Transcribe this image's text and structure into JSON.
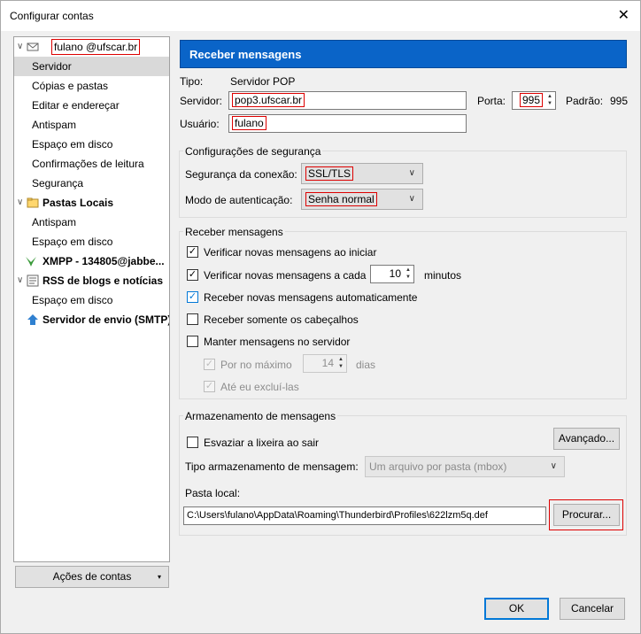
{
  "window": {
    "title": "Configurar contas",
    "close": "✕"
  },
  "tree": {
    "account": "fulano @ufscar.br",
    "account_items": [
      "Servidor",
      "Cópias e pastas",
      "Editar e endereçar",
      "Antispam",
      "Espaço em disco",
      "Confirmações de leitura",
      "Segurança"
    ],
    "local": "Pastas Locais",
    "local_items": [
      "Antispam",
      "Espaço em disco"
    ],
    "xmpp": "XMPP - 134805@jabbe...",
    "rss": "RSS de blogs e notícias",
    "rss_items": [
      "Espaço em disco"
    ],
    "smtp": "Servidor de envio (SMTP)"
  },
  "account_actions": "Ações de contas",
  "header": "Receber mensagens",
  "server": {
    "type_label": "Tipo:",
    "type_value": "Servidor POP",
    "server_label": "Servidor:",
    "server_value": "pop3.ufscar.br",
    "port_label": "Porta:",
    "port_value": "995",
    "default_label": "Padrão:",
    "default_value": "995",
    "user_label": "Usuário:",
    "user_value": "fulano"
  },
  "security": {
    "title": "Configurações de segurança",
    "conn_label": "Segurança da conexão:",
    "conn_value": "SSL/TLS",
    "auth_label": "Modo de autenticação:",
    "auth_value": "Senha normal"
  },
  "receive": {
    "title": "Receber mensagens",
    "check_startup": "Verificar novas mensagens ao iniciar",
    "check_every": "Verificar novas mensagens a cada",
    "minutes_value": "10",
    "minutes_label": "minutos",
    "auto_download": "Receber novas mensagens automaticamente",
    "headers_only": "Receber somente os cabeçalhos",
    "leave_on_server": "Manter mensagens no servidor",
    "max_label": "Por no máximo",
    "max_value": "14",
    "days_label": "dias",
    "until_deleted": "Até eu excluí-las"
  },
  "storage": {
    "title": "Armazenamento de mensagens",
    "empty_trash": "Esvaziar a lixeira ao sair",
    "advanced": "Avançado...",
    "type_label": "Tipo armazenamento de mensagem:",
    "type_value": "Um arquivo por pasta (mbox)",
    "local_label": "Pasta local:",
    "local_value": "C:\\Users\\fulano\\AppData\\Roaming\\Thunderbird\\Profiles\\622lzm5q.def",
    "browse": "Procurar..."
  },
  "footer": {
    "ok": "OK",
    "cancel": "Cancelar"
  },
  "colors": {
    "header_bg": "#0a64c8",
    "highlight": "#d00000",
    "check_blue": "#0078d7"
  }
}
